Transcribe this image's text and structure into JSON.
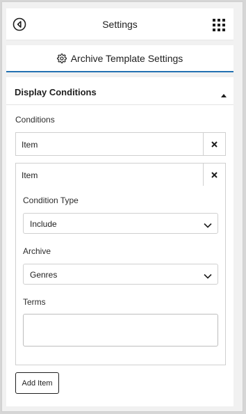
{
  "header": {
    "title": "Settings",
    "back_icon": "back-circle-icon",
    "grid_icon": "grid-menu-icon"
  },
  "tab": {
    "label": "Archive Template Settings",
    "icon": "gear-icon",
    "active_color": "#2271b1"
  },
  "section": {
    "title": "Display Conditions",
    "expanded": true,
    "conditions_label": "Conditions",
    "items": [
      {
        "label": "Item",
        "collapsed": true
      },
      {
        "label": "Item",
        "collapsed": false,
        "condition_type_label": "Condition Type",
        "condition_type_value": "Include",
        "archive_label": "Archive",
        "archive_value": "Genres",
        "terms_label": "Terms",
        "terms_value": ""
      }
    ],
    "add_button": "Add Item"
  }
}
